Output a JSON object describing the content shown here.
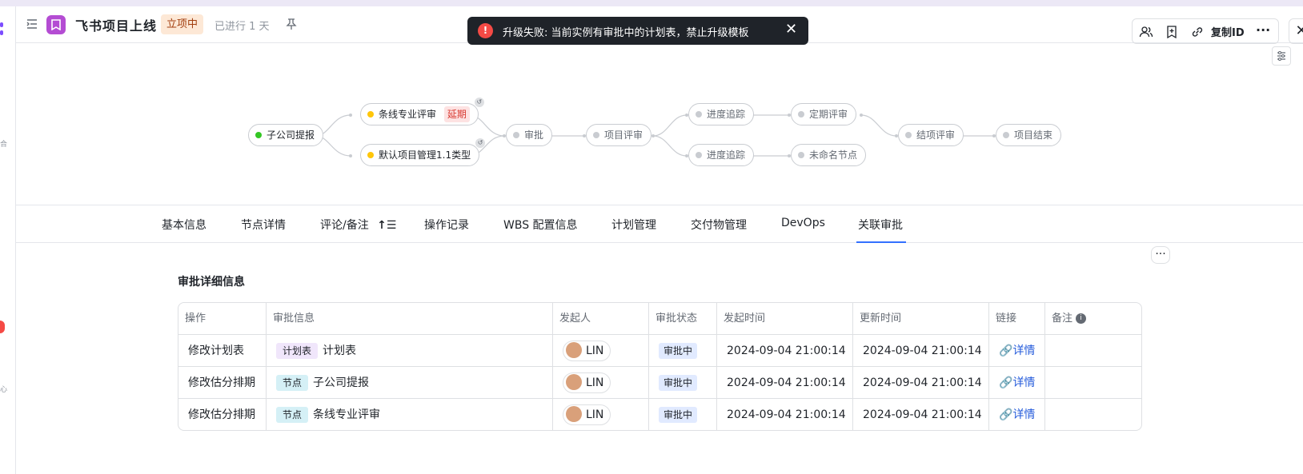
{
  "header": {
    "title": "飞书项目上线",
    "status_tag": "立项中",
    "elapsed": "已进行 1 天",
    "copy_id_label": "复制ID"
  },
  "toast": {
    "message": "升级失败: 当前实例有审批中的计划表，禁止升级模板"
  },
  "flow": {
    "nodes": [
      {
        "label": "子公司提报",
        "status": "done",
        "color": "#34c724"
      },
      {
        "label": "条线专业评审",
        "status": "active",
        "color": "#ffc60a",
        "badge": "延期"
      },
      {
        "label": "默认项目管理1.1类型",
        "status": "active",
        "color": "#ffc60a"
      },
      {
        "label": "审批",
        "status": "pending",
        "color": "#c9ccd1"
      },
      {
        "label": "项目评审",
        "status": "pending",
        "color": "#c9ccd1"
      },
      {
        "label": "进度追踪",
        "status": "pending",
        "color": "#c9ccd1"
      },
      {
        "label": "定期评审",
        "status": "pending",
        "color": "#c9ccd1"
      },
      {
        "label": "进度追踪",
        "status": "pending",
        "color": "#c9ccd1"
      },
      {
        "label": "未命名节点",
        "status": "pending",
        "color": "#c9ccd1"
      },
      {
        "label": "结项评审",
        "status": "pending",
        "color": "#c9ccd1"
      },
      {
        "label": "项目结束",
        "status": "pending",
        "color": "#c9ccd1"
      }
    ]
  },
  "tabs": [
    "基本信息",
    "节点详情",
    "评论/备注",
    "操作记录",
    "WBS 配置信息",
    "计划管理",
    "交付物管理",
    "DevOps",
    "关联审批"
  ],
  "active_tab": "关联审批",
  "section_title": "审批详细信息",
  "table": {
    "headers": [
      "操作",
      "审批信息",
      "发起人",
      "审批状态",
      "发起时间",
      "更新时间",
      "链接",
      "备注"
    ],
    "rows": [
      {
        "op": "修改计划表",
        "type": "计划表",
        "type_color": "#f0e6fb",
        "name": "计划表",
        "user": "LIN",
        "status": "审批中",
        "start": "2024-09-04 21:00:14",
        "update": "2024-09-04 21:00:14",
        "link": "详情"
      },
      {
        "op": "修改估分排期",
        "type": "节点",
        "type_color": "#d5f0f6",
        "name": "子公司提报",
        "user": "LIN",
        "status": "审批中",
        "start": "2024-09-04 21:00:14",
        "update": "2024-09-04 21:00:14",
        "link": "详情"
      },
      {
        "op": "修改估分排期",
        "type": "节点",
        "type_color": "#d5f0f6",
        "name": "条线专业评审",
        "user": "LIN",
        "status": "审批中",
        "start": "2024-09-04 21:00:14",
        "update": "2024-09-04 21:00:14",
        "link": "详情"
      }
    ]
  }
}
